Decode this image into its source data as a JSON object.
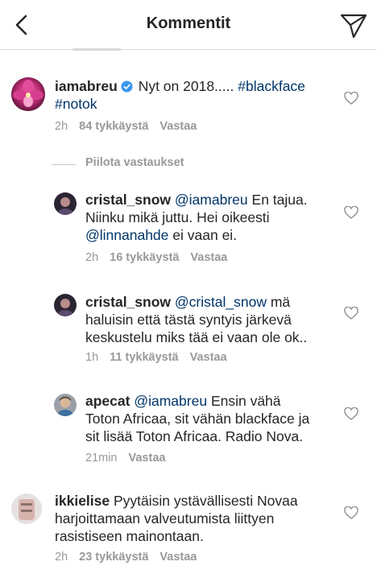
{
  "header": {
    "title": "Kommentit"
  },
  "comments": [
    {
      "username": "iamabreu",
      "verified": true,
      "text": "Nyt on 2018.....",
      "tags": [
        "#blackface",
        "#notok"
      ],
      "time": "2h",
      "likes": "84 tykkäystä",
      "reply": "Vastaa"
    },
    {
      "username": "cristal_snow",
      "mention": "@iamabreu",
      "text1": "En tajua.",
      "text2": "Niinku mikä juttu. Hei oikeesti",
      "mention2": "@linnanahde",
      "text3": "ei vaan ei.",
      "time": "2h",
      "likes": "16 tykkäystä",
      "reply": "Vastaa"
    },
    {
      "username": "cristal_snow",
      "mention": "@cristal_snow",
      "text1": "mä",
      "text2": "haluisin että tästä syntyis järkevä",
      "text3": "keskustelu miks tää ei vaan ole ok..",
      "time": "1h",
      "likes": "11 tykkäystä",
      "reply": "Vastaa"
    },
    {
      "username": "apecat",
      "mention": "@iamabreu",
      "text1": "Ensin vähä",
      "text2": "Toton Africaa, sit vähän blackface ja",
      "text3": "sit lisää Toton Africaa. Radio Nova.",
      "time": "21min",
      "reply": "Vastaa"
    },
    {
      "username": "ikkielise",
      "text1": "Pyytäisin ystävällisesti Novaa",
      "text2": "harjoittamaan valveutumista liittyen",
      "text3": "rasistiseen mainontaan.",
      "time": "2h",
      "likes": "23 tykkäystä",
      "reply": "Vastaa"
    }
  ],
  "hide_replies": "Piilota vastaukset",
  "colors": {
    "link": "#003569",
    "meta": "#999999",
    "text": "#262626",
    "verified": "#3897f0"
  }
}
